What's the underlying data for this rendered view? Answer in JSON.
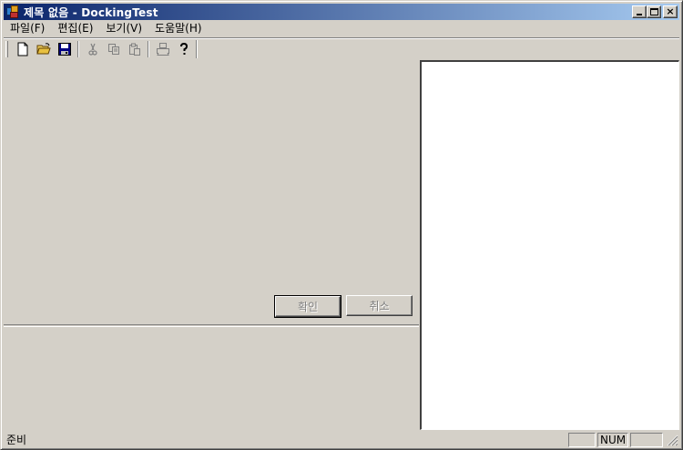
{
  "window": {
    "title": "제목 없음 - DockingTest",
    "caption_close_glyph": "×"
  },
  "menubar": {
    "items": [
      {
        "label": "파일(F)"
      },
      {
        "label": "편집(E)"
      },
      {
        "label": "보기(V)"
      },
      {
        "label": "도움말(H)"
      }
    ]
  },
  "toolbar": {
    "buttons": [
      "new-file-icon",
      "open-folder-icon",
      "save-icon",
      "cut-icon",
      "copy-icon",
      "paste-icon",
      "print-icon",
      "help-icon"
    ]
  },
  "dialog": {
    "ok_label": "확인",
    "cancel_label": "취소"
  },
  "statusbar": {
    "text": "준비",
    "caps": "",
    "num": "NUM",
    "scrl": ""
  },
  "colors": {
    "face": "#d4d0c8",
    "title_start": "#0a246a",
    "title_end": "#a6caf0",
    "workspace": "#ffffff"
  }
}
